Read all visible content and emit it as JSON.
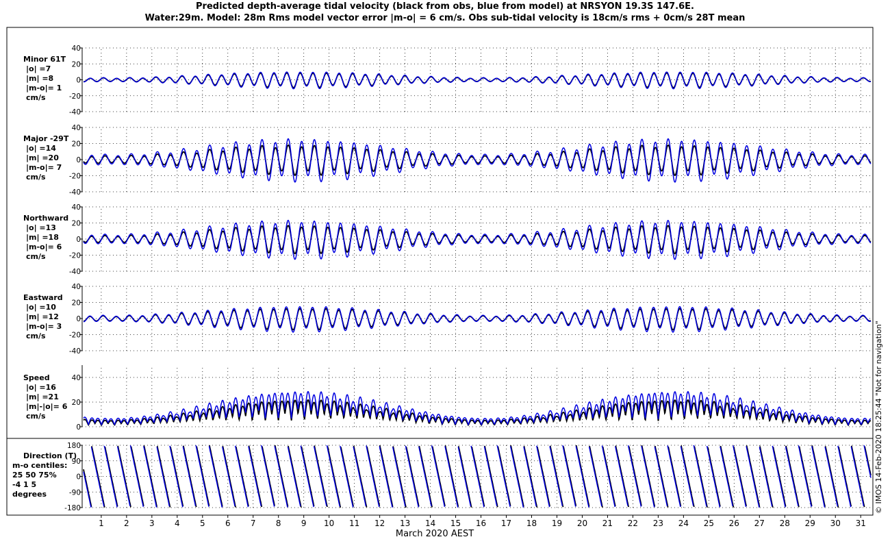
{
  "title_line1": "Predicted depth-average tidal velocity (black from obs, blue from model) at NRSYON 19.3S 147.6E.",
  "title_line2": "Water:29m. Model: 28m  Rms model vector error |m-o| = 6 cm/s. Obs sub-tidal velocity is 18cm/s rms + 0cm/s 28T mean",
  "side_note": "© IMOS 14-Feb-2020 18:25:44  \"Not for navigation\"",
  "colors": {
    "obs": "#000000",
    "model": "#0000e0",
    "grid": "#000000"
  },
  "chart_data": {
    "type": "line",
    "xlabel": "March 2020 AEST",
    "x_ticks": [
      "1",
      "2",
      "3",
      "4",
      "5",
      "6",
      "7",
      "8",
      "9",
      "10",
      "11",
      "12",
      "13",
      "14",
      "15",
      "16",
      "17",
      "18",
      "19",
      "20",
      "21",
      "22",
      "23",
      "24",
      "25",
      "26",
      "27",
      "28",
      "29",
      "30",
      "31"
    ],
    "x_range_days": [
      0.3,
      31.4
    ],
    "grid": true,
    "panels": [
      {
        "id": "minor",
        "label": [
          "Minor 61T",
          "|o| =7",
          "|m| =8",
          "|m-o|= 1",
          "cm/s"
        ],
        "ylim": [
          -40,
          40
        ],
        "yticks": [
          "40",
          "20",
          "0",
          "-20",
          "-40"
        ],
        "yvals": [
          40,
          20,
          0,
          -20,
          -40
        ],
        "series": [
          {
            "name": "obs",
            "amplitude_rms": 7
          },
          {
            "name": "model",
            "amplitude_rms": 8
          }
        ]
      },
      {
        "id": "major",
        "label": [
          "Major -29T",
          "|o| =14",
          "|m| =20",
          "|m-o|= 7",
          "cm/s"
        ],
        "ylim": [
          -40,
          40
        ],
        "yticks": [
          "40",
          "20",
          "0",
          "-20",
          "-40"
        ],
        "yvals": [
          40,
          20,
          0,
          -20,
          -40
        ],
        "series": [
          {
            "name": "obs",
            "amplitude_rms": 14
          },
          {
            "name": "model",
            "amplitude_rms": 20
          }
        ]
      },
      {
        "id": "north",
        "label": [
          "Northward",
          "|o| =13",
          "|m| =18",
          "|m-o|= 6",
          "cm/s"
        ],
        "ylim": [
          -40,
          40
        ],
        "yticks": [
          "40",
          "20",
          "0",
          "-20",
          "-40"
        ],
        "yvals": [
          40,
          20,
          0,
          -20,
          -40
        ],
        "series": [
          {
            "name": "obs",
            "amplitude_rms": 13
          },
          {
            "name": "model",
            "amplitude_rms": 18
          }
        ]
      },
      {
        "id": "east",
        "label": [
          "Eastward",
          "|o| =10",
          "|m| =12",
          "|m-o|= 3",
          "cm/s"
        ],
        "ylim": [
          -40,
          40
        ],
        "yticks": [
          "40",
          "20",
          "0",
          "-20",
          "-40"
        ],
        "yvals": [
          40,
          20,
          0,
          -20,
          -40
        ],
        "series": [
          {
            "name": "obs",
            "amplitude_rms": 10
          },
          {
            "name": "model",
            "amplitude_rms": 12
          }
        ]
      },
      {
        "id": "speed",
        "label": [
          "Speed",
          "|o| =16",
          "|m| =21",
          "|m|-|o|= 6",
          "cm/s"
        ],
        "ylim": [
          0,
          50
        ],
        "yticks": [
          "40",
          "20",
          "0"
        ],
        "yvals": [
          40,
          20,
          0
        ],
        "series": [
          {
            "name": "obs",
            "amplitude_rms": 16
          },
          {
            "name": "model",
            "amplitude_rms": 21
          }
        ]
      },
      {
        "id": "direction",
        "label": [
          "Direction (T)",
          "m-o centiles:",
          "25  50  75%",
          "-4  1  5",
          "degrees"
        ],
        "ylim": [
          -180,
          180
        ],
        "yticks": [
          "180",
          "90",
          "0",
          "-90",
          "-180"
        ],
        "yvals": [
          180,
          90,
          0,
          -90,
          -180
        ],
        "series": [
          {
            "name": "obs"
          },
          {
            "name": "model"
          }
        ]
      }
    ]
  }
}
